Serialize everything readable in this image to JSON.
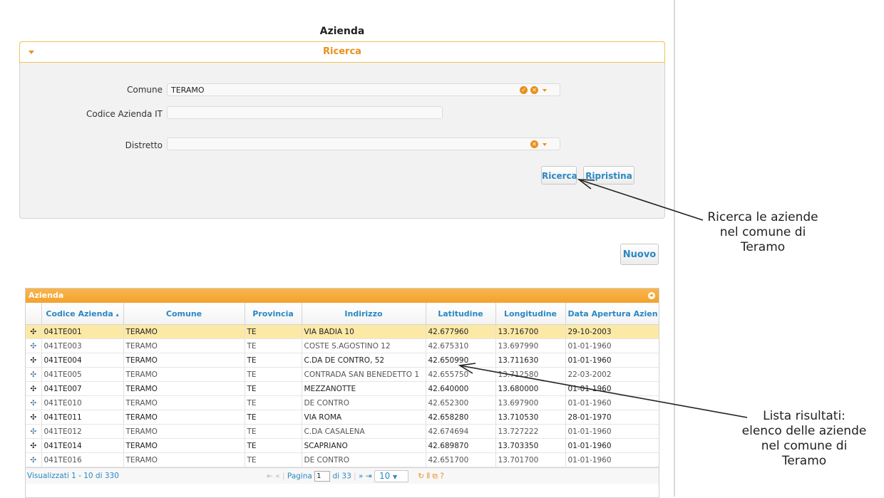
{
  "page": {
    "title": "Azienda"
  },
  "search": {
    "header": "Ricerca",
    "fields": {
      "comune_label": "Comune",
      "comune_value": "TERAMO",
      "codice_label": "Codice Azienda IT",
      "codice_value": "",
      "distretto_label": "Distretto",
      "distretto_value": ""
    },
    "buttons": {
      "search": "Ricerca",
      "reset": "Ripristina"
    }
  },
  "new_button": "Nuovo",
  "grid": {
    "caption": "Azienda",
    "columns": [
      "Codice Azienda",
      "Comune",
      "Provincia",
      "Indirizzo",
      "Latitudine",
      "Longitudine",
      "Data Apertura Azien"
    ],
    "rows": [
      [
        "041TE001",
        "TERAMO",
        "TE",
        "VIA BADIA 10",
        "42.677960",
        "13.716700",
        "29-10-2003"
      ],
      [
        "041TE003",
        "TERAMO",
        "TE",
        "COSTE S.AGOSTINO 12",
        "42.675310",
        "13.697990",
        "01-01-1960"
      ],
      [
        "041TE004",
        "TERAMO",
        "TE",
        "C.DA DE CONTRO, 52",
        "42.650990",
        "13.711630",
        "01-01-1960"
      ],
      [
        "041TE005",
        "TERAMO",
        "TE",
        "CONTRADA SAN BENEDETTO 1",
        "42.655750",
        "13.712580",
        "22-03-2002"
      ],
      [
        "041TE007",
        "TERAMO",
        "TE",
        "MEZZANOTTE",
        "42.640000",
        "13.680000",
        "01-01-1960"
      ],
      [
        "041TE010",
        "TERAMO",
        "TE",
        "DE CONTRO",
        "42.652300",
        "13.697900",
        "01-01-1960"
      ],
      [
        "041TE011",
        "TERAMO",
        "TE",
        "VIA ROMA",
        "42.658280",
        "13.710530",
        "28-01-1970"
      ],
      [
        "041TE012",
        "TERAMO",
        "TE",
        "C.DA CASALENA",
        "42.674694",
        "13.727222",
        "01-01-1960"
      ],
      [
        "041TE014",
        "TERAMO",
        "TE",
        "SCAPRIANO",
        "42.689870",
        "13.703350",
        "01-01-1960"
      ],
      [
        "041TE016",
        "TERAMO",
        "TE",
        "DE CONTRO",
        "42.651700",
        "13.701700",
        "01-01-1960"
      ]
    ],
    "pager": {
      "info": "Visualizzati 1 - 10 di 330",
      "page_label": "Pagina",
      "page_value": "1",
      "of_label": "di 33",
      "rows_per_page": "10"
    }
  },
  "annotations": {
    "search_note": "Ricerca le aziende\nnel comune di\nTeramo",
    "list_note": "Lista risultati:\nelenco delle aziende\nnel comune di\nTeramo"
  }
}
